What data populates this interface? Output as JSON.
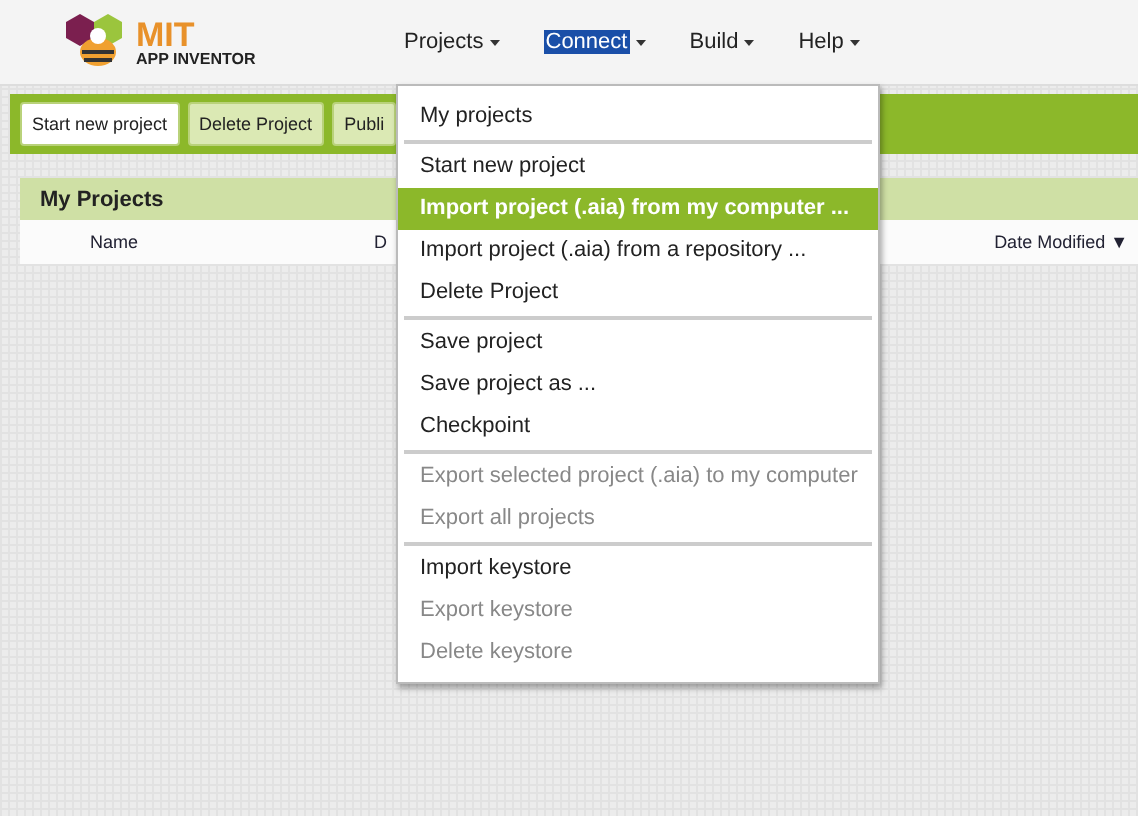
{
  "logo": {
    "title": "MIT",
    "subtitle": "APP INVENTOR"
  },
  "nav": [
    {
      "label": "Projects",
      "selected": false
    },
    {
      "label": "Connect",
      "selected": true
    },
    {
      "label": "Build",
      "selected": false
    },
    {
      "label": "Help",
      "selected": false
    }
  ],
  "toolbar": [
    {
      "label": "Start new project",
      "selected": true
    },
    {
      "label": "Delete Project",
      "selected": false
    },
    {
      "label": "Publi",
      "selected": false
    }
  ],
  "panel": {
    "title": "My Projects",
    "columns": [
      "Name",
      "D",
      "Date Modified ▼"
    ]
  },
  "menu": {
    "groups": [
      [
        {
          "label": "My projects",
          "disabled": false,
          "selected": false
        }
      ],
      [
        {
          "label": "Start new project",
          "disabled": false,
          "selected": false
        },
        {
          "label": "Import project (.aia) from my computer ...",
          "disabled": false,
          "selected": true
        },
        {
          "label": "Import project (.aia) from a repository ...",
          "disabled": false,
          "selected": false
        },
        {
          "label": "Delete Project",
          "disabled": false,
          "selected": false
        }
      ],
      [
        {
          "label": "Save project",
          "disabled": false,
          "selected": false
        },
        {
          "label": "Save project as ...",
          "disabled": false,
          "selected": false
        },
        {
          "label": "Checkpoint",
          "disabled": false,
          "selected": false
        }
      ],
      [
        {
          "label": "Export selected project (.aia) to my computer",
          "disabled": true,
          "selected": false
        },
        {
          "label": "Export all projects",
          "disabled": true,
          "selected": false
        }
      ],
      [
        {
          "label": "Import keystore",
          "disabled": false,
          "selected": false
        },
        {
          "label": "Export keystore",
          "disabled": true,
          "selected": false
        },
        {
          "label": "Delete keystore",
          "disabled": true,
          "selected": false
        }
      ]
    ]
  }
}
